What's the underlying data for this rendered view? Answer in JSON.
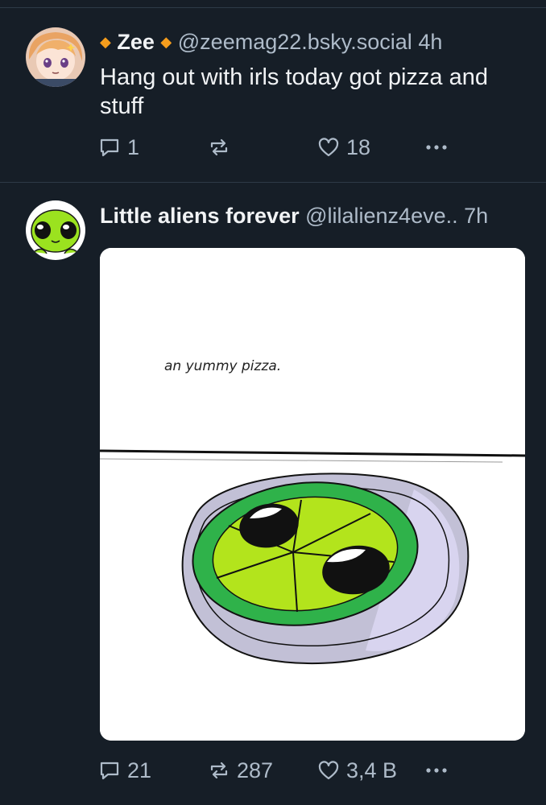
{
  "feed": {
    "posts": [
      {
        "author": "Zee",
        "handle": "@zeemag22.bsky.social",
        "time": "4h",
        "text": "Hang out with irls today got pizza and stuff",
        "replies": "1",
        "reposts": "",
        "likes": "18",
        "avatar_icon": "anime-avatar-icon",
        "accent_color": "#f59d1d"
      },
      {
        "author": "Little aliens forever",
        "handle": "@lilalienz4eve..",
        "time": "7h",
        "image_caption": "an yummy pizza.",
        "replies": "21",
        "reposts": "287",
        "likes": "3,4 B",
        "avatar_icon": "alien-avatar-icon",
        "pizza_color": "#b3e41c"
      }
    ]
  }
}
